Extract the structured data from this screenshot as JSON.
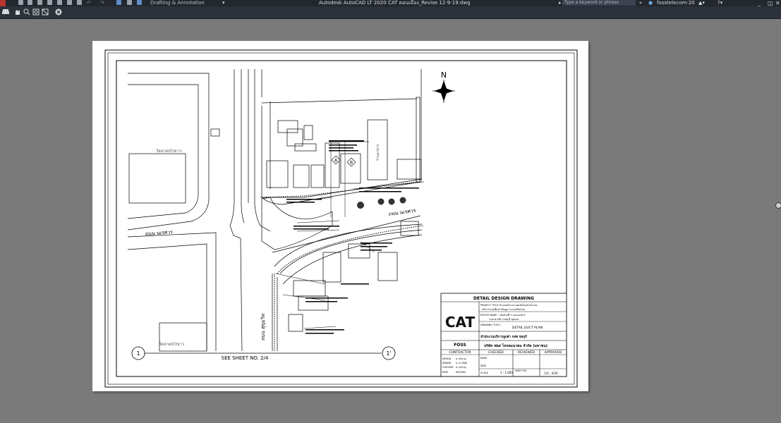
{
  "app": {
    "title": "Autodesk AutoCAD LT 2020    CAT ดอนเมือง_Revise 12-9-19.dwg",
    "workspace": "Drafting & Annotation",
    "search_placeholder": "Type a keyword or phrase",
    "user": "fosstelecom-20",
    "accent_color": "#2b4a7a"
  },
  "drawing": {
    "north_label": "N",
    "road_labels": [
      "ถนน นเรศวร",
      "ถนน นเรศวร",
      "ถนน สุขุมวิท"
    ],
    "building_labels": [
      "วัดลาดบัวขาว",
      "วัดลาดบัวขาว",
      "ร้านอาหาร"
    ],
    "marker_a": "A",
    "marker_b": "B",
    "match_left": "1",
    "match_right": "1'",
    "see_sheet": "SEE SHEET NO. 2/4"
  },
  "title_block": {
    "heading": "DETAIL DESIGN DRAWING",
    "logo": "CAT",
    "project_title_label": "PROJECT TITLE :",
    "project_title_1": "จ้างก่อสร้างงานเคเบิลใยแก้วนำแสง",
    "project_title_2": "บริการระบบสื่อสารข้อมูล ระบบเครือข่าย",
    "route_label": "ROUTE NAME :",
    "route_value": "เส้นทางที่ 1 ถนนนเรศวร",
    "route_value_2": "ระยะทางถึง จ.ชลบุรี ชุมสาย",
    "drawing_title_label": "DRAWING TITLE :",
    "drawing_title": "DETAIL DUCT PLAN",
    "agency": "สำนักงานบริการลูกค้า กสท ชลบุรี",
    "foss_logo": "FOSS",
    "company": "บริษัท ฟอส โทรคมนาคม จำกัด (มหาชน)",
    "contractor": "CONTRACTOR",
    "checked": "CHECKED",
    "reviewed": "REVIEWED",
    "approved": "APPROVED",
    "rows": [
      {
        "label": "DESIGN",
        "value": "A. สุวิชาญ"
      },
      {
        "label": "DRAWN",
        "value": "A. ประสิทธิ์"
      },
      {
        "label": "CHECKED",
        "value": "A. สุวิชาญ"
      },
      {
        "label": "DATE",
        "value": "8/5/2562"
      }
    ],
    "name_label": "NAME",
    "date_label": "DATE",
    "scale_label": "SCALE",
    "scale_value": "1 : 1,000",
    "sheet_label": "SHEET NO.",
    "sheet_value": "1/4 , 4/30"
  }
}
